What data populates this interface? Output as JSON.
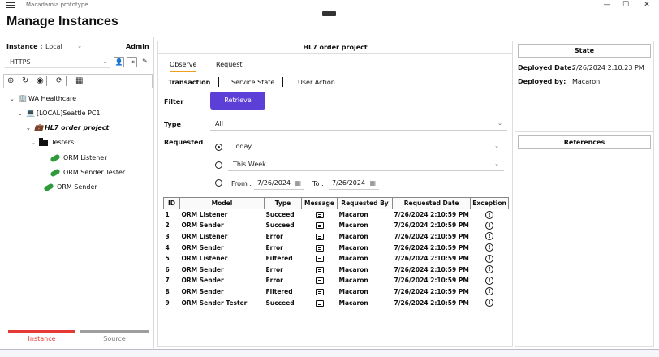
{
  "window": {
    "app_name": "Macadamia prototype",
    "minimize": "—",
    "maximize": "☐",
    "close": "✕"
  },
  "page_title": "Manage Instances",
  "left": {
    "instance_label": "Instance :",
    "instance_value": "Local",
    "admin_label": "Admin",
    "protocol_value": "HTTPS",
    "tree": [
      {
        "label": "WA Healthcare",
        "level": 0
      },
      {
        "label": "[LOCAL]Seattle PC1",
        "level": 1
      },
      {
        "label": "HL7 order project",
        "level": 2
      },
      {
        "label": "Testers",
        "level": 3
      },
      {
        "label": "ORM Listener",
        "level": 4
      },
      {
        "label": "ORM Sender Tester",
        "level": 4
      },
      {
        "label": "ORM Sender",
        "level": 3
      }
    ],
    "tabs": {
      "instance": "Instance",
      "source": "Source"
    }
  },
  "center": {
    "title": "HL7 order project",
    "tabs": {
      "observe": "Observe",
      "request": "Request"
    },
    "subtabs": {
      "transaction": "Transaction",
      "service_state": "Service State",
      "user_action": "User Action"
    },
    "filter_label": "Filter",
    "retrieve_label": "Retrieve",
    "type_label": "Type",
    "type_value": "All",
    "requested_label": "Requested",
    "today": "Today",
    "this_week": "This Week",
    "from_label": "From :",
    "from_date": "7/26/2024",
    "to_label": "To :",
    "to_date": "7/26/2024",
    "table": {
      "headers": [
        "ID",
        "Model",
        "Type",
        "Message",
        "Requested By",
        "Requested Date",
        "Exception"
      ],
      "rows": [
        {
          "id": "1",
          "model": "ORM Listener",
          "type": "Succeed",
          "by": "Macaron",
          "date": "7/26/2024 2:10:59 PM"
        },
        {
          "id": "2",
          "model": "ORM Sender",
          "type": "Succeed",
          "by": "Macaron",
          "date": "7/26/2024 2:10:59 PM"
        },
        {
          "id": "3",
          "model": "ORM Listener",
          "type": "Error",
          "by": "Macaron",
          "date": "7/26/2024 2:10:59 PM"
        },
        {
          "id": "4",
          "model": "ORM Sender",
          "type": "Error",
          "by": "Macaron",
          "date": "7/26/2024 2:10:59 PM"
        },
        {
          "id": "5",
          "model": "ORM Listener",
          "type": "Filtered",
          "by": "Macaron",
          "date": "7/26/2024 2:10:59 PM"
        },
        {
          "id": "6",
          "model": "ORM Sender",
          "type": "Error",
          "by": "Macaron",
          "date": "7/26/2024 2:10:59 PM"
        },
        {
          "id": "7",
          "model": "ORM Sender",
          "type": "Error",
          "by": "Macaron",
          "date": "7/26/2024 2:10:59 PM"
        },
        {
          "id": "8",
          "model": "ORM Sender",
          "type": "Filtered",
          "by": "Macaron",
          "date": "7/26/2024 2:10:59 PM"
        },
        {
          "id": "9",
          "model": "ORM Sender Tester",
          "type": "Succeed",
          "by": "Macaron",
          "date": "7/26/2024 2:10:59 PM"
        }
      ]
    }
  },
  "right": {
    "state_title": "State",
    "deployed_date_label": "Deployed Date:",
    "deployed_date_value": "7/26/2024 2:10:23 PM",
    "deployed_by_label": "Deployed by:",
    "deployed_by_value": "Macaron",
    "references_title": "References"
  },
  "colors": {
    "accent": "#5b3fd6",
    "tab_active": "#e53935",
    "observe_underline": "#f0a020",
    "plug": "#2e9a3a"
  }
}
